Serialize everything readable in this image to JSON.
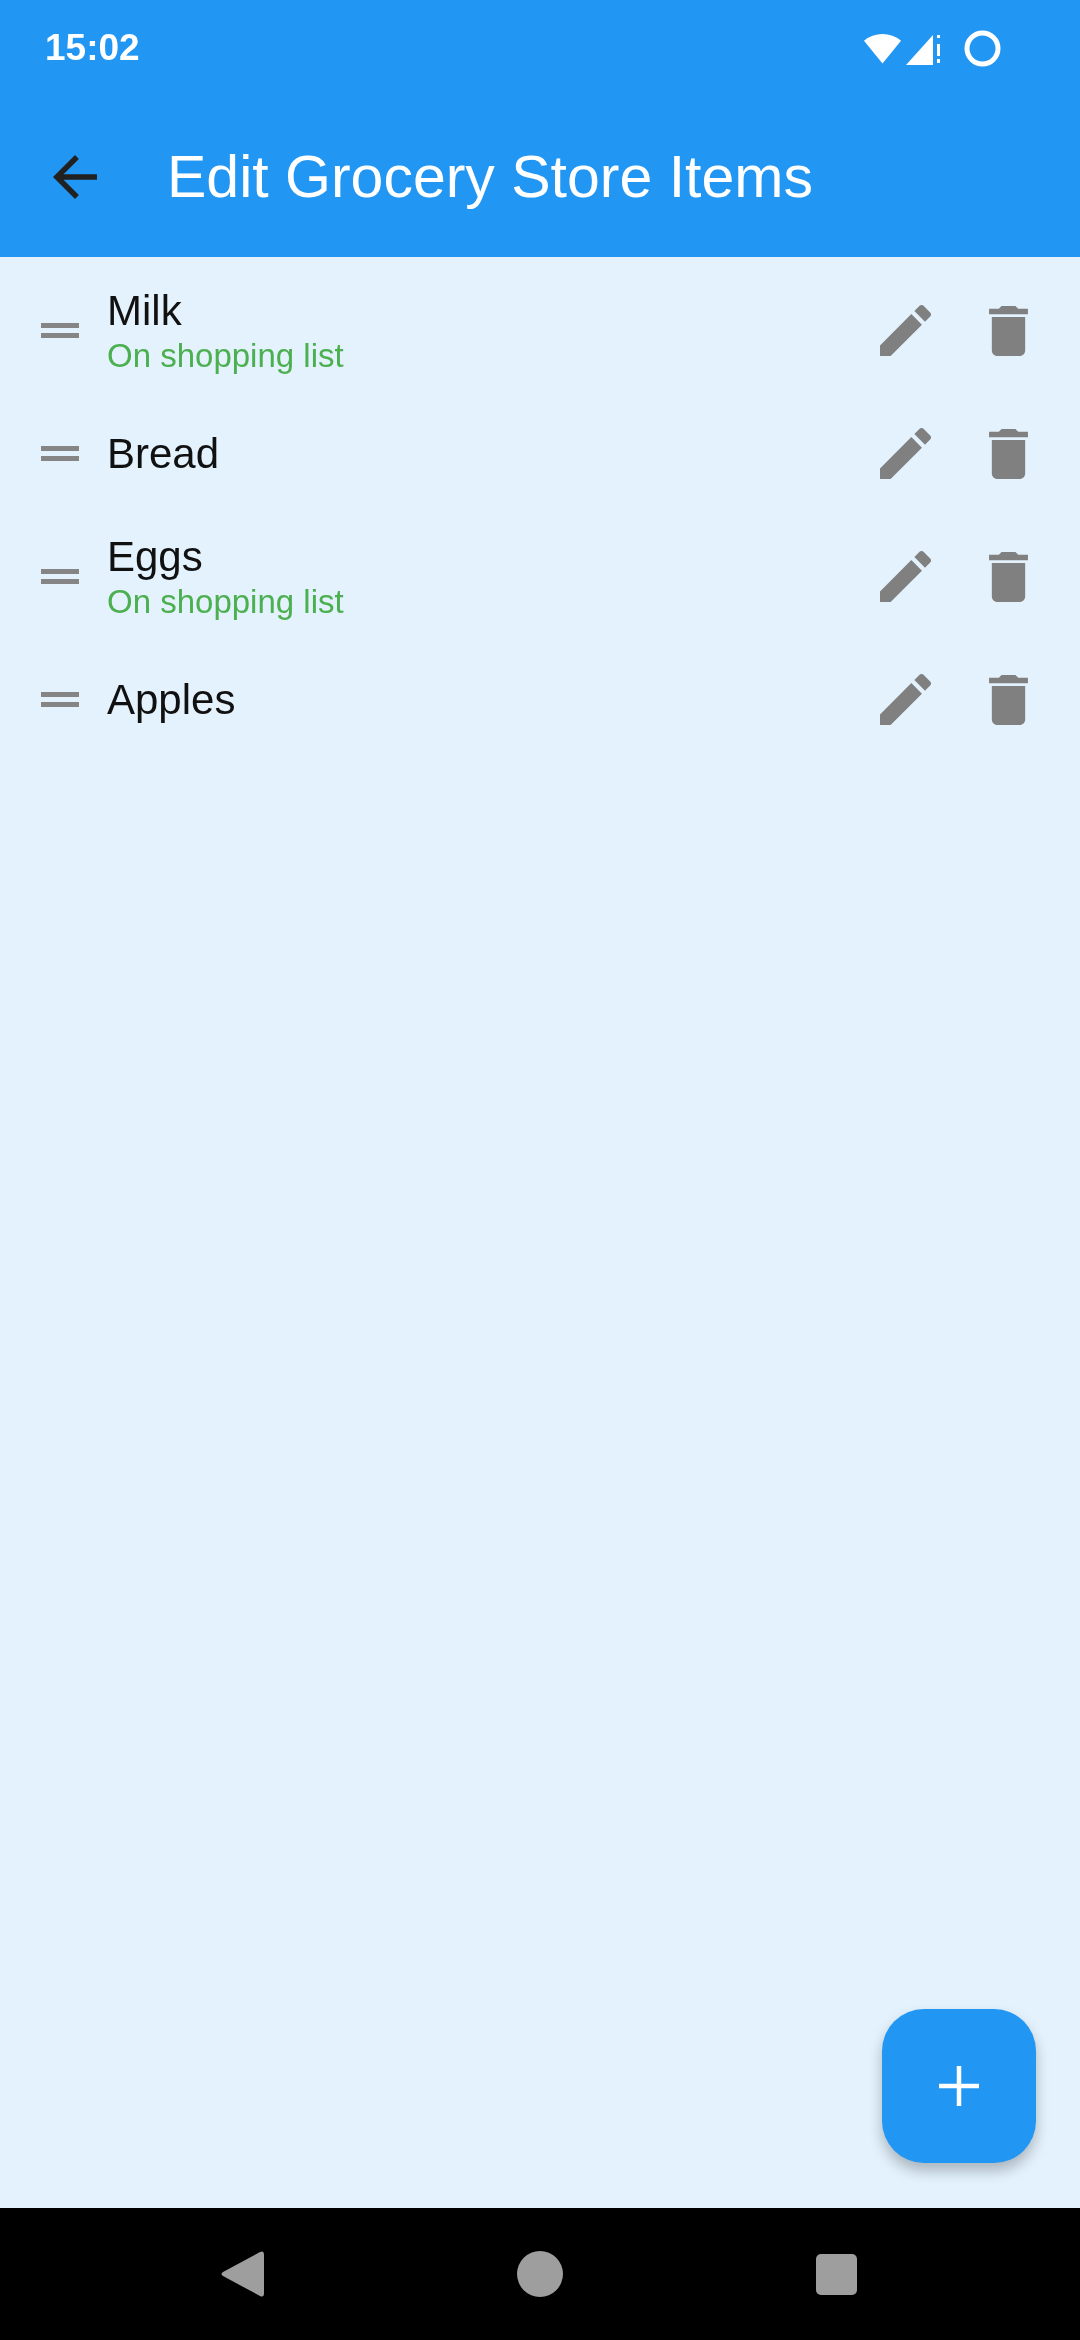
{
  "status_bar": {
    "time": "15:02"
  },
  "app_bar": {
    "title": "Edit Grocery Store Items"
  },
  "items": [
    {
      "name": "Milk",
      "status": "On shopping list"
    },
    {
      "name": "Bread"
    },
    {
      "name": "Eggs",
      "status": "On shopping list"
    },
    {
      "name": "Apples"
    }
  ]
}
